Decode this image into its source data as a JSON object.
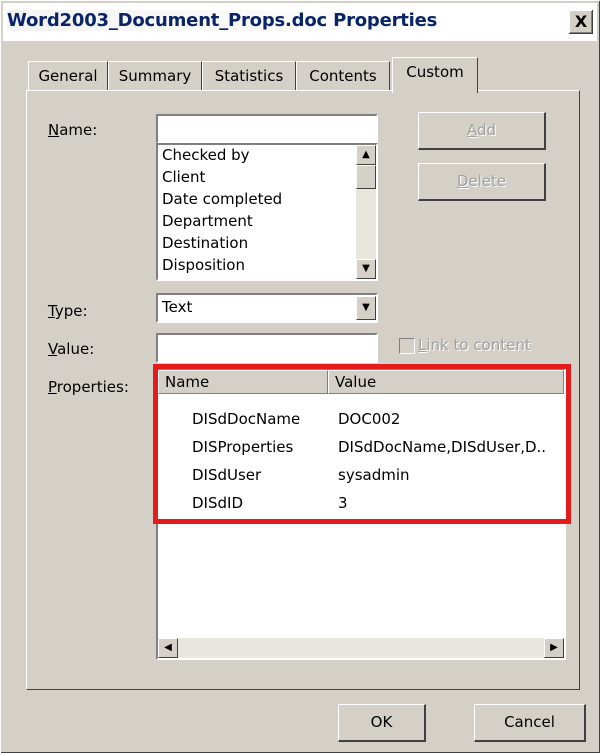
{
  "window": {
    "title": "Word2003_Document_Props.doc Properties",
    "close_label": "X"
  },
  "tabs": [
    {
      "label": "General",
      "active": false
    },
    {
      "label": "Summary",
      "active": false
    },
    {
      "label": "Statistics",
      "active": false
    },
    {
      "label": "Contents",
      "active": false
    },
    {
      "label": "Custom",
      "active": true
    }
  ],
  "name_field": {
    "label": "Name:",
    "value": ""
  },
  "name_list": {
    "items": [
      "Checked by",
      "Client",
      "Date completed",
      "Department",
      "Destination",
      "Disposition"
    ]
  },
  "buttons": {
    "add": "Add",
    "delete": "Delete",
    "ok": "OK",
    "cancel": "Cancel"
  },
  "type_field": {
    "label": "Type:",
    "value": "Text"
  },
  "value_field": {
    "label": "Value:",
    "value": ""
  },
  "link_to_content": {
    "label": "Link to content",
    "checked": false
  },
  "properties": {
    "label": "Properties:",
    "columns": [
      "Name",
      "Value"
    ],
    "rows": [
      {
        "name": "DISdDocName",
        "value": "DOC002"
      },
      {
        "name": "DISProperties",
        "value": "DISdDocName,DISdUser,D.."
      },
      {
        "name": "DISdUser",
        "value": "sysadmin"
      },
      {
        "name": "DISdID",
        "value": "3"
      }
    ]
  },
  "highlight_color": "#e31b1b"
}
